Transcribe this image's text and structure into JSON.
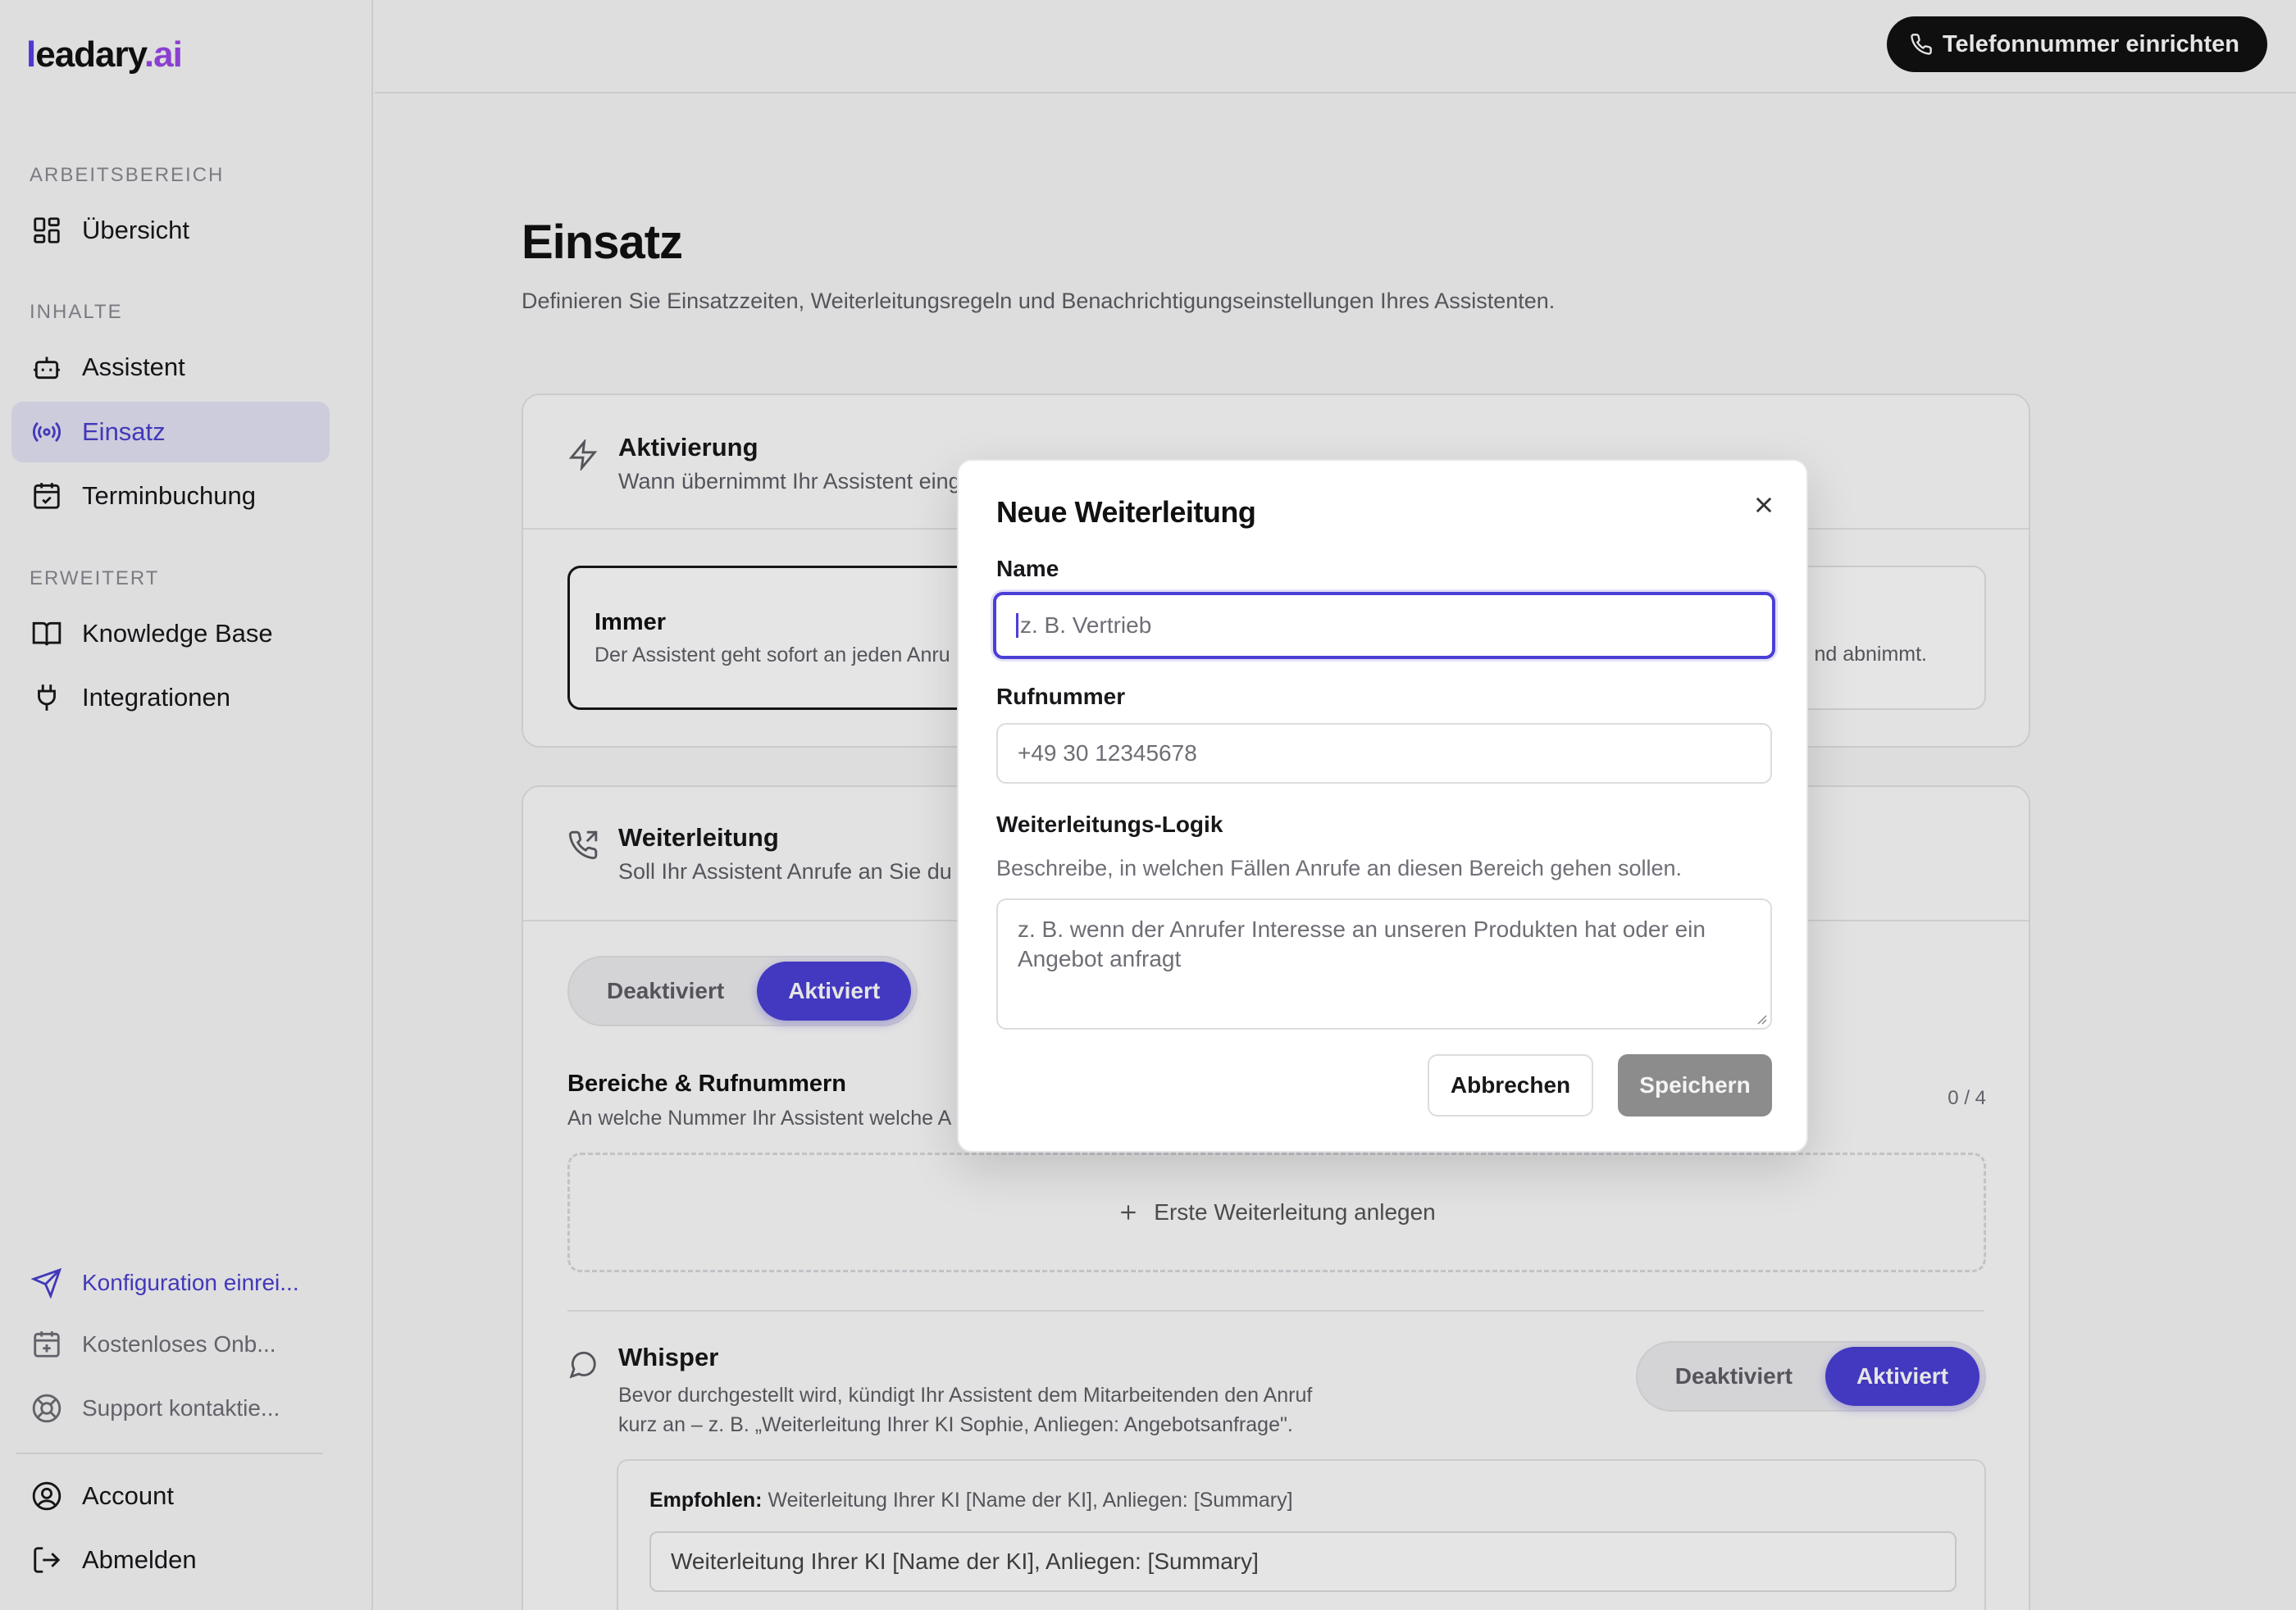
{
  "brand": {
    "logo_l": "l",
    "logo_main": "eadary",
    "logo_dot": ".",
    "logo_ai": "ai"
  },
  "sidebar": {
    "sections": [
      {
        "label": "ARBEITSBEREICH"
      },
      {
        "label": "INHALTE"
      },
      {
        "label": "ERWEITERT"
      }
    ],
    "items": [
      {
        "label": "Übersicht",
        "icon": "grid-icon"
      },
      {
        "label": "Assistent",
        "icon": "robot-icon"
      },
      {
        "label": "Einsatz",
        "icon": "broadcast-icon",
        "active": true
      },
      {
        "label": "Terminbuchung",
        "icon": "calendar-check-icon"
      },
      {
        "label": "Knowledge Base",
        "icon": "book-icon"
      },
      {
        "label": "Integrationen",
        "icon": "plug-icon"
      }
    ],
    "footer_links": [
      {
        "label": "Konfiguration einrei...",
        "icon": "send-icon"
      },
      {
        "label": "Kostenloses Onb...",
        "icon": "calendar-plus-icon"
      },
      {
        "label": "Support kontaktie...",
        "icon": "lifebuoy-icon"
      }
    ],
    "account": [
      {
        "label": "Account",
        "icon": "user-circle-icon"
      },
      {
        "label": "Abmelden",
        "icon": "logout-icon"
      }
    ]
  },
  "topbar": {
    "phone_button": "Telefonnummer einrichten"
  },
  "page": {
    "title": "Einsatz",
    "subtitle": "Definieren Sie Einsatzzeiten, Weiterleitungsregeln und Benachrichtigungseinstellungen Ihres Assistenten."
  },
  "activation": {
    "title": "Aktivierung",
    "desc": "Wann übernimmt Ihr Assistent eing",
    "option_always_title": "Immer",
    "option_always_desc": "Der Assistent geht sofort an jeden Anru",
    "option_right_desc": "nd abnimmt."
  },
  "forwarding": {
    "title": "Weiterleitung",
    "desc": "Soll Ihr Assistent Anrufe an Sie du",
    "toggle_off": "Deaktiviert",
    "toggle_on": "Aktiviert",
    "areas_title": "Bereiche & Rufnummern",
    "areas_desc": "An welche Nummer Ihr Assistent welche A",
    "count": "0 / 4",
    "add_first": "Erste Weiterleitung anlegen"
  },
  "whisper": {
    "title": "Whisper",
    "desc_line1": "Bevor durchgestellt wird, kündigt Ihr Assistent dem Mitarbeitenden den Anruf",
    "desc_line2": "kurz an – z. B. „Weiterleitung Ihrer KI Sophie, Anliegen: Angebotsanfrage\".",
    "toggle_off": "Deaktiviert",
    "toggle_on": "Aktiviert",
    "recommended_label": "Empfohlen:",
    "recommended_text": "Weiterleitung Ihrer KI [Name der KI], Anliegen: [Summary]",
    "input_value": "Weiterleitung Ihrer KI [Name der KI], Anliegen: [Summary]"
  },
  "modal": {
    "title": "Neue Weiterleitung",
    "name_label": "Name",
    "name_placeholder": "z. B. Vertrieb",
    "phone_label": "Rufnummer",
    "phone_placeholder": "+49 30 12345678",
    "logic_label": "Weiterleitungs-Logik",
    "logic_helper": "Beschreibe, in welchen Fällen Anrufe an diesen Bereich gehen sollen.",
    "logic_placeholder": "z. B. wenn der Anrufer Interesse an unseren Produkten hat oder ein Angebot anfragt",
    "cancel": "Abbrechen",
    "save": "Speichern"
  },
  "colors": {
    "accent": "#4b3fd6",
    "active_bg": "#e4e4f5",
    "save_disabled": "#8c8c8c"
  }
}
